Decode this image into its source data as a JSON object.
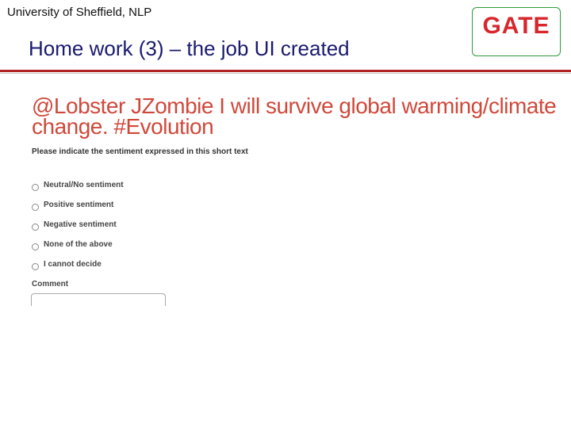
{
  "header": {
    "affiliation": "University of Sheffield, NLP",
    "title": "Home work (3) – the job UI created",
    "logo_text": "GATE",
    "accent_color": "#b22222",
    "logo_color": "#d8262b"
  },
  "job_ui": {
    "tweet_line1": "@Lobster JZombie I will survive global warming/climate",
    "tweet_line2": "change. #Evolution",
    "question": "Please indicate the sentiment expressed in this short text",
    "options": [
      "Neutral/No sentiment",
      "Positive sentiment",
      "Negative sentiment",
      "None of the above",
      "I cannot decide"
    ],
    "comment_label": "Comment"
  }
}
